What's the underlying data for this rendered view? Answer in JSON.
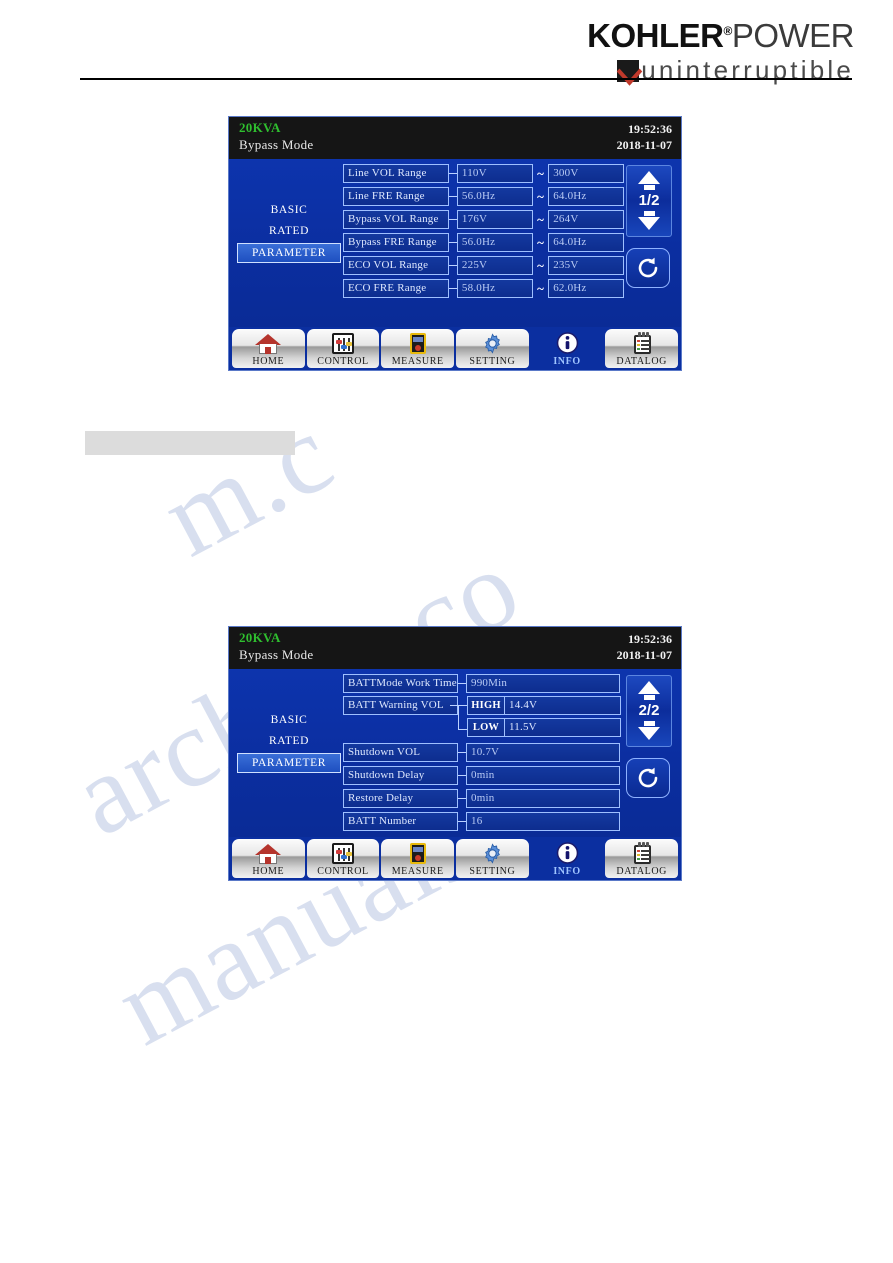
{
  "logo": {
    "brand_bold": "KOHLER",
    "registered": "®",
    "brand_light": "POWER",
    "tagline": "uninterruptible",
    "mark_color": "#c0392b"
  },
  "watermark": {
    "line1": "m.c",
    "line2": "archive.co",
    "line3": "manualslib"
  },
  "screens": [
    {
      "id": "parameter-page-1",
      "header": {
        "rating": "20KVA",
        "mode": "Bypass Mode",
        "time": "19:52:36",
        "date": "2018-11-07"
      },
      "sidebar": {
        "items": [
          {
            "label": "BASIC",
            "active": false
          },
          {
            "label": "RATED",
            "active": false
          },
          {
            "label": "PARAMETER",
            "active": true
          }
        ]
      },
      "nav": {
        "page_indicator": "1/2",
        "up_label": "up-arrow",
        "down_label": "down-arrow",
        "refresh_label": "refresh"
      },
      "rows": [
        {
          "label": "Line VOL Range",
          "min": "110V",
          "sep": "~",
          "max": "300V"
        },
        {
          "label": "Line FRE Range",
          "min": "56.0Hz",
          "sep": "~",
          "max": "64.0Hz"
        },
        {
          "label": "Bypass VOL Range",
          "min": "176V",
          "sep": "~",
          "max": "264V"
        },
        {
          "label": "Bypass FRE Range",
          "min": "56.0Hz",
          "sep": "~",
          "max": "64.0Hz"
        },
        {
          "label": "ECO VOL Range",
          "min": "225V",
          "sep": "~",
          "max": "235V"
        },
        {
          "label": "ECO FRE Range",
          "min": "58.0Hz",
          "sep": "~",
          "max": "62.0Hz"
        }
      ]
    },
    {
      "id": "parameter-page-2",
      "header": {
        "rating": "20KVA",
        "mode": "Bypass Mode",
        "time": "19:52:36",
        "date": "2018-11-07"
      },
      "sidebar": {
        "items": [
          {
            "label": "BASIC",
            "active": false
          },
          {
            "label": "RATED",
            "active": false
          },
          {
            "label": "PARAMETER",
            "active": true
          }
        ]
      },
      "nav": {
        "page_indicator": "2/2",
        "up_label": "up-arrow",
        "down_label": "down-arrow",
        "refresh_label": "refresh"
      },
      "rows": [
        {
          "label": "BATTMode Work Time",
          "value": "990Min"
        },
        {
          "label": "BATT Warning VOL",
          "sub": [
            {
              "tag": "HIGH",
              "value": "14.4V"
            },
            {
              "tag": "LOW",
              "value": "11.5V"
            }
          ]
        },
        {
          "label": "Shutdown VOL",
          "value": "10.7V"
        },
        {
          "label": "Shutdown Delay",
          "value": "0min"
        },
        {
          "label": "Restore Delay",
          "value": "0min"
        },
        {
          "label": "BATT Number",
          "value": "16"
        }
      ]
    }
  ],
  "toolbar": {
    "items": [
      {
        "label": "HOME",
        "icon": "home-icon",
        "active": false
      },
      {
        "label": "CONTROL",
        "icon": "sliders-icon",
        "active": false
      },
      {
        "label": "MEASURE",
        "icon": "multimeter-icon",
        "active": false
      },
      {
        "label": "SETTING",
        "icon": "gear-icon",
        "active": false
      },
      {
        "label": "INFO",
        "icon": "info-icon",
        "active": true
      },
      {
        "label": "DATALOG",
        "icon": "notepad-icon",
        "active": false
      }
    ]
  },
  "colors": {
    "panel_blue": "#0b2fa0",
    "header_black": "#151515",
    "rating_green": "#2fbf2f",
    "active_blue": "#3a6fd8"
  }
}
